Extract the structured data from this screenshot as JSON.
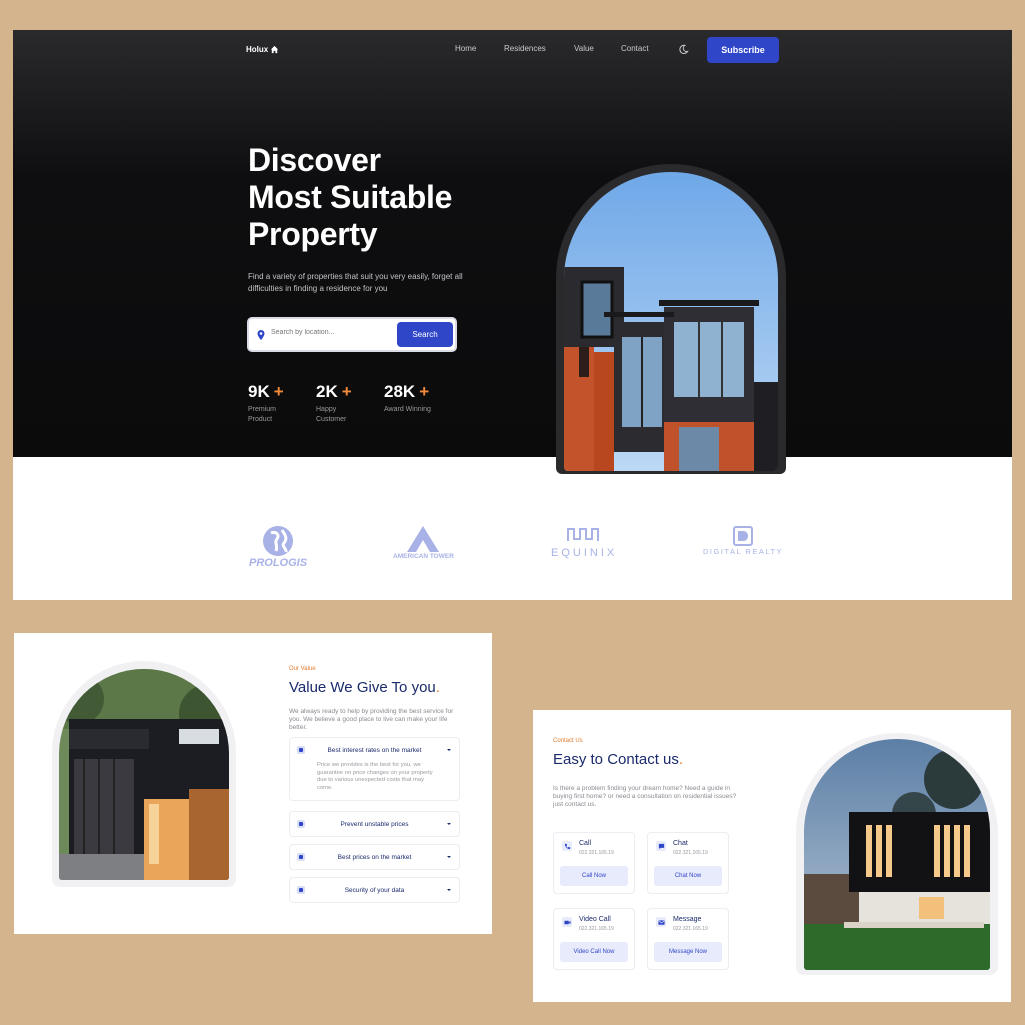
{
  "colors": {
    "accent": "#2f46c9",
    "orange": "#f28a3a",
    "navy": "#1a2a6c",
    "background": "#d4b48c"
  },
  "nav": {
    "logo": "Holux",
    "links": [
      "Home",
      "Residences",
      "Value",
      "Contact"
    ],
    "subscribe": "Subscribe",
    "theme_icon": "moon-icon"
  },
  "hero": {
    "title_lines": [
      "Discover",
      "Most Suitable",
      "Property"
    ],
    "description": "Find a variety of properties that suit you very easily, forget all difficulties in finding a residence for you",
    "search": {
      "placeholder": "Search by location...",
      "button": "Search"
    },
    "stats": [
      {
        "value": "9K",
        "plus": "+",
        "label": "Premium Product"
      },
      {
        "value": "2K",
        "plus": "+",
        "label": "Happy Customer"
      },
      {
        "value": "28K",
        "plus": "+",
        "label": "Award Winning"
      }
    ]
  },
  "brands": [
    "PROLOGIS",
    "AMERICAN TOWER",
    "EQUINIX",
    "DIGITAL REALTY"
  ],
  "value": {
    "eyebrow": "Our Value",
    "title": "Value We Give To you",
    "description": "We always ready to help by providing the best service for you. We believe a good place to live can make your life better.",
    "items": [
      {
        "title": "Best interest rates on the market",
        "body": "Price we provides is the best for you, we guarantee no price changes on your property due to various unexpected costs that may come."
      },
      {
        "title": "Prevent unstable prices"
      },
      {
        "title": "Best prices on the market"
      },
      {
        "title": "Security of your data"
      }
    ]
  },
  "contact": {
    "eyebrow": "Contact Us",
    "title": "Easy to Contact us",
    "description": "Is there a problem finding your dream home? Need a guide in buying first home? or need a consultation on residential issues? just contact us.",
    "methods": [
      {
        "title": "Call",
        "number": "022.321.165.19",
        "button": "Call Now",
        "icon": "phone-icon"
      },
      {
        "title": "Chat",
        "number": "022.321.165.19",
        "button": "Chat Now",
        "icon": "chat-icon"
      },
      {
        "title": "Video Call",
        "number": "022.321.165.19",
        "button": "Video Call Now",
        "icon": "video-icon"
      },
      {
        "title": "Message",
        "number": "022.321.165.19",
        "button": "Message Now",
        "icon": "message-icon"
      }
    ]
  }
}
